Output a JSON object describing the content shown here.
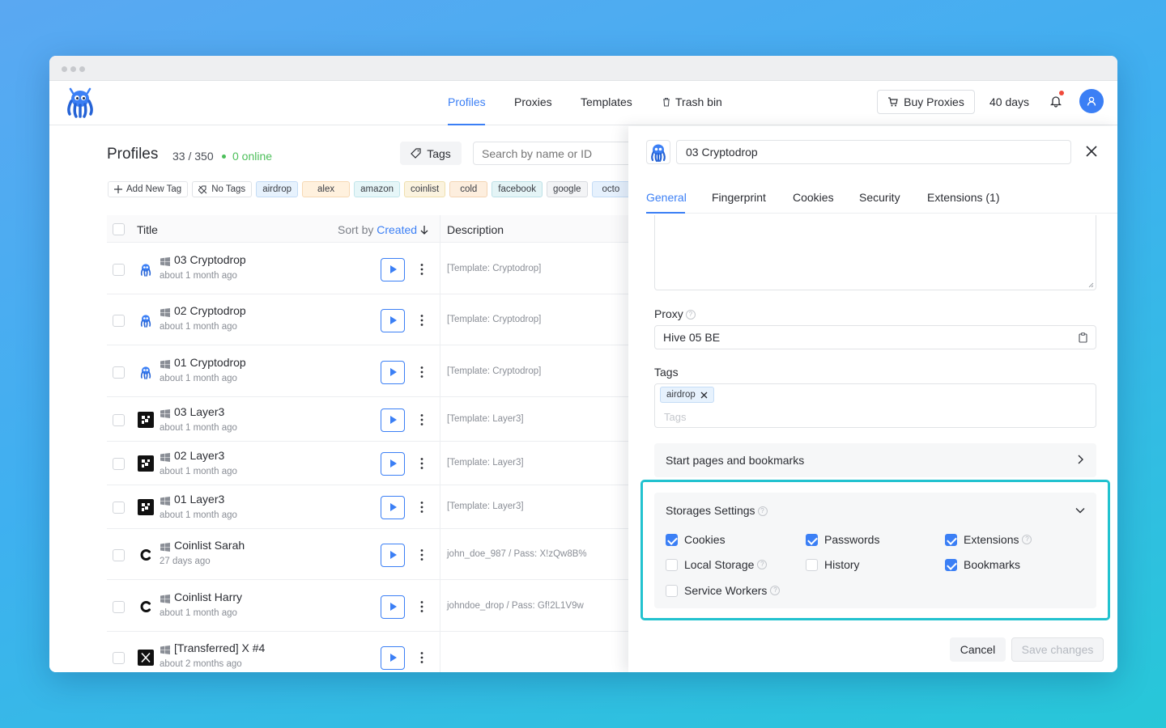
{
  "nav": {
    "tabs": [
      {
        "label": "Profiles",
        "active": true
      },
      {
        "label": "Proxies",
        "active": false
      },
      {
        "label": "Templates",
        "active": false
      },
      {
        "label": "Trash bin",
        "active": false
      }
    ],
    "buy_proxies": "Buy Proxies",
    "days": "40 days",
    "accent": "#3b7ff5"
  },
  "profiles": {
    "heading": "Profiles",
    "count": "33 / 350",
    "online": "0 online",
    "tags_button": "Tags",
    "search_placeholder": "Search by name or ID",
    "tag_chips": [
      "Add New Tag",
      "No Tags",
      "airdrop",
      "alex",
      "amazon",
      "coinlist",
      "cold",
      "facebook",
      "google",
      "octo"
    ],
    "columns": {
      "title": "Title",
      "sort_prefix": "Sort by",
      "sort_field": "Created",
      "description": "Description"
    },
    "rows": [
      {
        "name": "03 Cryptodrop",
        "ago": "about 1 month ago",
        "desc": "[Template: Cryptodrop]",
        "icon": "octo-logo-icon"
      },
      {
        "name": "02 Cryptodrop",
        "ago": "about 1 month ago",
        "desc": "[Template: Cryptodrop]",
        "icon": "octo-logo-icon"
      },
      {
        "name": "01 Cryptodrop",
        "ago": "about 1 month ago",
        "desc": "[Template: Cryptodrop]",
        "icon": "octo-logo-icon"
      },
      {
        "name": "03 Layer3",
        "ago": "about 1 month ago",
        "desc": "[Template: Layer3]",
        "icon": "layer3-logo-icon"
      },
      {
        "name": "02 Layer3",
        "ago": "about 1 month ago",
        "desc": "[Template: Layer3]",
        "icon": "layer3-logo-icon"
      },
      {
        "name": "01 Layer3",
        "ago": "about 1 month ago",
        "desc": "[Template: Layer3]",
        "icon": "layer3-logo-icon"
      },
      {
        "name": "Coinlist Sarah",
        "ago": "27 days ago",
        "desc": "john_doe_987 / Pass: X!zQw8B%",
        "icon": "coinlist-logo-icon"
      },
      {
        "name": "Coinlist Harry",
        "ago": "about 1 month ago",
        "desc": "johndoe_drop / Pass: Gf!2L1V9w",
        "icon": "coinlist-logo-icon"
      },
      {
        "name": "[Transferred] X #4",
        "ago": "about 2 months ago",
        "desc": "",
        "icon": "x-logo-icon"
      }
    ]
  },
  "panel": {
    "profile_name": "03 Cryptodrop",
    "tabs": [
      "General",
      "Fingerprint",
      "Cookies",
      "Security",
      "Extensions (1)"
    ],
    "proxy_label": "Proxy",
    "proxy_value": "Hive 05 BE",
    "tags_label": "Tags",
    "tag": "airdrop",
    "tags_placeholder": "Tags",
    "start_pages": "Start pages and bookmarks",
    "storage_title": "Storages Settings",
    "storage_options": [
      {
        "label": "Cookies",
        "checked": true,
        "help": false
      },
      {
        "label": "Passwords",
        "checked": true,
        "help": false
      },
      {
        "label": "Extensions",
        "checked": true,
        "help": true
      },
      {
        "label": "Local Storage",
        "checked": false,
        "help": true
      },
      {
        "label": "History",
        "checked": false,
        "help": false
      },
      {
        "label": "Bookmarks",
        "checked": true,
        "help": false
      },
      {
        "label": "Service Workers",
        "checked": false,
        "help": true
      }
    ],
    "cancel": "Cancel",
    "save": "Save changes",
    "highlight_color": "#22c2cf"
  }
}
